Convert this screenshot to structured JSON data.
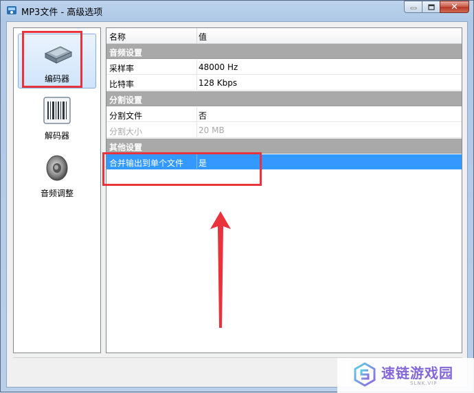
{
  "window": {
    "title": "MP3文件 - 高级选项",
    "app_icon": "mp3-app-icon",
    "caption_buttons": {
      "minimize_icon": "minimize-icon",
      "maximize_icon": "maximize-icon",
      "close_icon": "close-icon",
      "close_glyph": "✕"
    }
  },
  "sidebar": {
    "items": [
      {
        "label": "编码器",
        "icon": "encoder-device-icon",
        "selected": true
      },
      {
        "label": "解码器",
        "icon": "decoder-barcode-icon",
        "selected": false
      },
      {
        "label": "音频调整",
        "icon": "speaker-icon",
        "selected": false
      }
    ]
  },
  "grid": {
    "columns": [
      "名称",
      "值"
    ],
    "rows": [
      {
        "type": "category",
        "name": "音频设置"
      },
      {
        "type": "property",
        "name": "采样率",
        "value": "48000 Hz"
      },
      {
        "type": "property",
        "name": "比特率",
        "value": "128 Kbps"
      },
      {
        "type": "category",
        "name": "分割设置"
      },
      {
        "type": "property",
        "name": "分割文件",
        "value": "否"
      },
      {
        "type": "property",
        "name": "分割大小",
        "value": "20 MB",
        "disabled": true
      },
      {
        "type": "category",
        "name": "其他设置"
      },
      {
        "type": "property",
        "name": "合并输出到单个文件",
        "value": "是",
        "selected": true
      }
    ]
  },
  "annotations": {
    "highlight_color": "#e8323c",
    "arrow_direction": "up"
  },
  "watermark": {
    "text": "速链游戏园",
    "subtext": "SLNK.VIP",
    "logo_icon": "hexagon-s-logo-icon"
  },
  "colors": {
    "selection": "#3399ff",
    "category_bg": "#a9a9a9"
  }
}
